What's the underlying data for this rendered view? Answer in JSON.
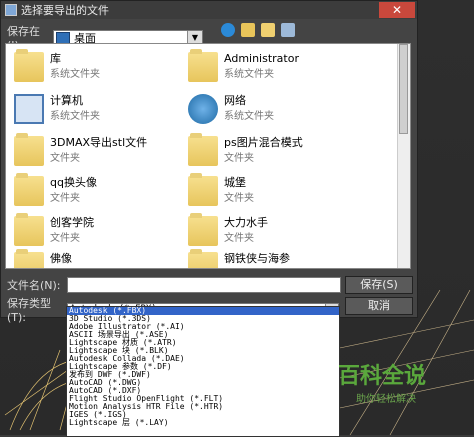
{
  "dialog": {
    "title": "选择要导出的文件",
    "close_label": "✕"
  },
  "location": {
    "label": "保存在(I):",
    "value": "桌面"
  },
  "toolbar": {
    "icons": [
      "back-icon",
      "up-folder-icon",
      "new-folder-icon",
      "view-menu-icon"
    ]
  },
  "files": [
    {
      "name": "库",
      "sub": "系统文件夹",
      "icon": "library-folder-icon"
    },
    {
      "name": "Administrator",
      "sub": "系统文件夹",
      "icon": "user-folder-icon"
    },
    {
      "name": "计算机",
      "sub": "系统文件夹",
      "icon": "computer-icon"
    },
    {
      "name": "网络",
      "sub": "系统文件夹",
      "icon": "network-icon"
    },
    {
      "name": "3DMAX导出stl文件",
      "sub": "文件夹",
      "icon": "folder-icon"
    },
    {
      "name": "ps图片混合模式",
      "sub": "文件夹",
      "icon": "folder-icon"
    },
    {
      "name": "qq换头像",
      "sub": "文件夹",
      "icon": "folder-icon"
    },
    {
      "name": "城堡",
      "sub": "文件夹",
      "icon": "folder-icon"
    },
    {
      "name": "创客学院",
      "sub": "文件夹",
      "icon": "folder-icon"
    },
    {
      "name": "大力水手",
      "sub": "文件夹",
      "icon": "folder-icon"
    },
    {
      "name": "佛像",
      "sub": "",
      "icon": "folder-icon"
    },
    {
      "name": "钢铁侠与海参",
      "sub": "",
      "icon": "folder-icon"
    }
  ],
  "filename": {
    "label": "文件名(N):",
    "value": ""
  },
  "filetype": {
    "label": "保存类型(T):",
    "value": "Autodesk (*.FBX)"
  },
  "buttons": {
    "save": "保存(S)",
    "cancel": "取消"
  },
  "type_options": [
    "Autodesk (*.FBX)",
    "3D Studio (*.3DS)",
    "Adobe Illustrator (*.AI)",
    "ASCII 场景导出 (*.ASE)",
    "Lightscape 材质 (*.ATR)",
    "Lightscape 块 (*.BLK)",
    "Autodesk Collada (*.DAE)",
    "Lightscape 参数 (*.DF)",
    "发布到 DWF (*.DWF)",
    "AutoCAD (*.DWG)",
    "AutoCAD (*.DXF)",
    "Flight Studio OpenFlight (*.FLT)",
    "Motion Analysis HTR File (*.HTR)",
    "IGES (*.IGS)",
    "Lightscape 层 (*.LAY)"
  ],
  "watermark": {
    "title": "百科全说",
    "sub": "助你轻松解决"
  }
}
